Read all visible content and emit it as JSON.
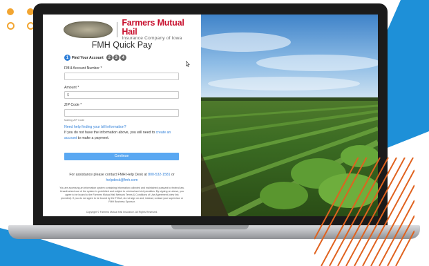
{
  "colors": {
    "accent_blue": "#2f7fd8",
    "button_blue": "#5aa8f2",
    "brand_red": "#c8102e",
    "decoration_orange": "#f2a531",
    "background_blue": "#1e90d8"
  },
  "logo": {
    "brand_name": "Farmers Mutual Hail",
    "brand_subtitle": "Insurance Company of Iowa"
  },
  "page_title": "FMH Quick Pay",
  "steps": [
    {
      "number": "1",
      "label": "Find Your Account",
      "active": true
    },
    {
      "number": "2",
      "label": "",
      "active": false
    },
    {
      "number": "3",
      "label": "",
      "active": false
    },
    {
      "number": "4",
      "label": "",
      "active": false
    }
  ],
  "form": {
    "account_label": "FMH Account Number *",
    "account_value": "",
    "amount_label": "Amount *",
    "amount_prefix": "$",
    "amount_value": "",
    "zip_label": "ZIP Code *",
    "zip_value": "",
    "zip_hint": "Mailing ZIP Code",
    "help_link": "Need help finding your bill information?",
    "help_text_before": "If you do not have the information above, you will need to ",
    "help_text_link": "create an account",
    "help_text_after": " to make a payment.",
    "continue_label": "Continue"
  },
  "assistance": {
    "text_before": "For assistance please contact FMH Help Desk at ",
    "phone": "800-532-1581",
    "text_mid": " or",
    "email": "helpdesk@fmh.com"
  },
  "legal_text": "You are accessing an information system containing information collected and maintained pursuant to federal law. Unauthorized use of the system is prohibited and subject to criminal and civil penalties. By signing on above, you agree to be bound to the Farmers Mutual Hail Network Terms & Conditions of Use Agreement (view link provided). If you do not agree to be bound by the TOUA, do not sign on and, instead, contact your supervisor or FMH Business Sponsor.",
  "copyright": "Copyright © Farmers Mutual Hail Insurance. All Rights Reserved."
}
